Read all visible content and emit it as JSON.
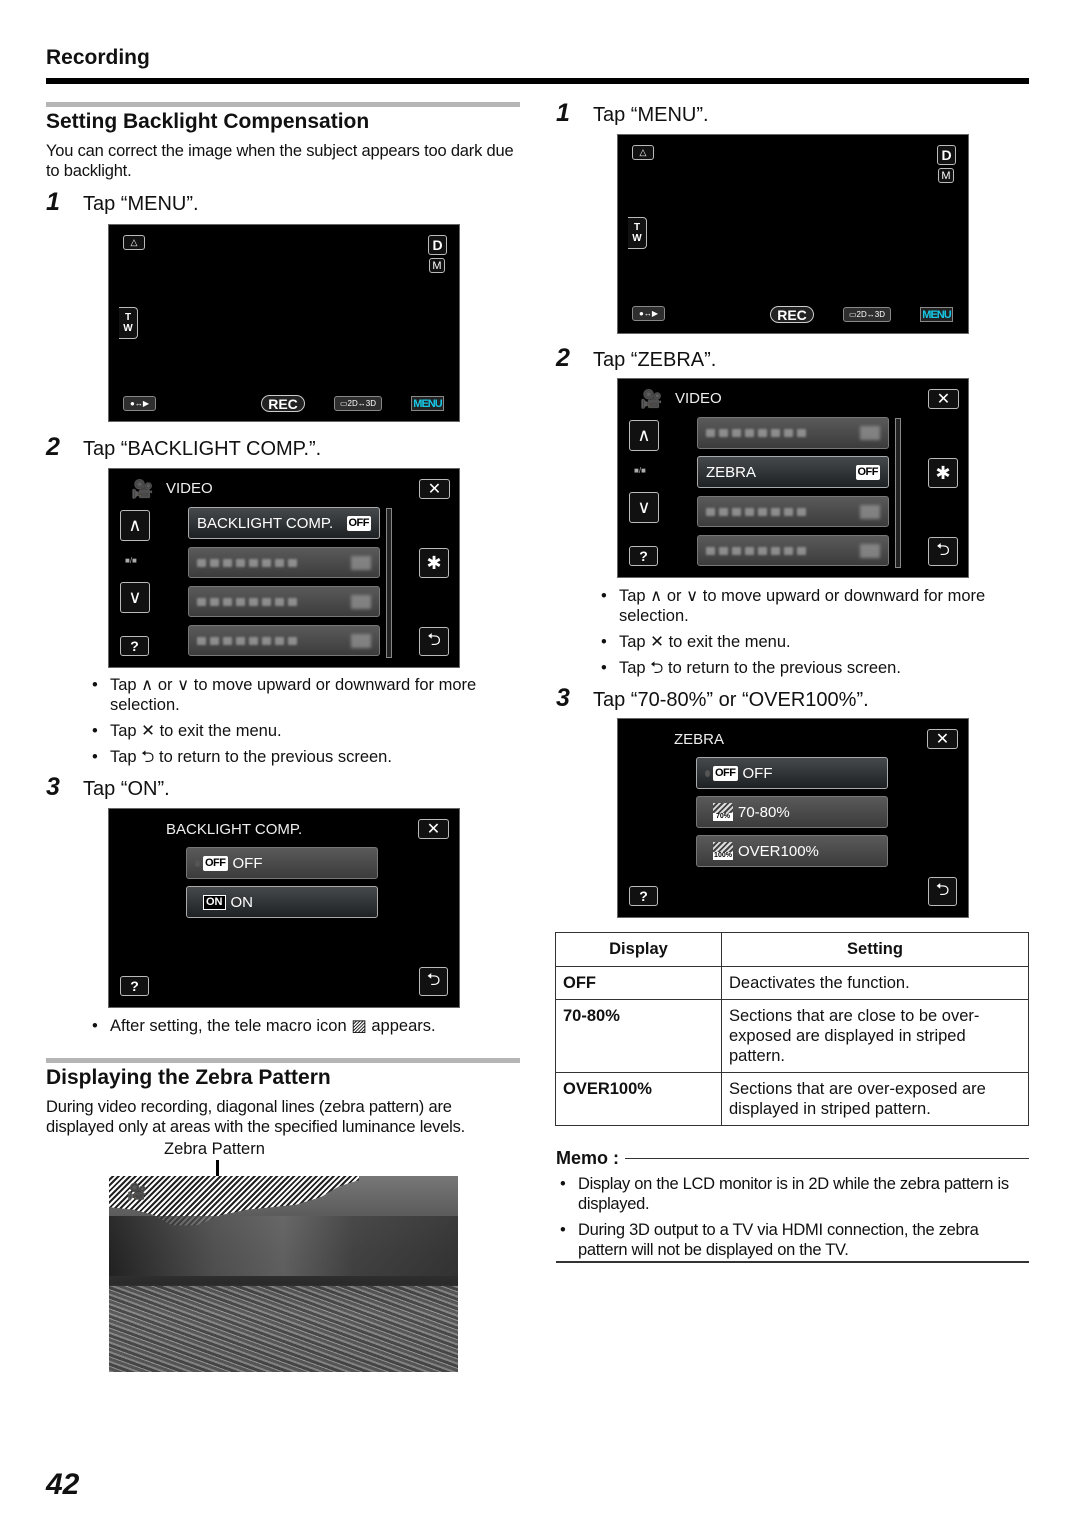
{
  "header": {
    "title": "Recording"
  },
  "left": {
    "section1": {
      "title": "Setting Backlight Compensation",
      "intro": "You can correct the image when the subject appears too dark due to backlight.",
      "step1": {
        "num": "1",
        "text": "Tap “MENU”."
      },
      "step2": {
        "num": "2",
        "text": "Tap “BACKLIGHT COMP.”."
      },
      "step3": {
        "num": "3",
        "text": "Tap “ON”."
      },
      "bullets": [
        "Tap ∧ or ∨ to move upward or downward for more selection.",
        "Tap ✕ to exit the menu.",
        "Tap ⮌ to return to the previous screen."
      ],
      "after_note": "After setting, the tele macro icon ▨ appears."
    },
    "section2": {
      "title": "Displaying the Zebra Pattern",
      "intro": "During video recording, diagonal lines (zebra pattern) are displayed only at areas with the specified luminance levels.",
      "callout": "Zebra Pattern"
    }
  },
  "right": {
    "step1": {
      "num": "1",
      "text": "Tap “MENU”."
    },
    "step2": {
      "num": "2",
      "text": "Tap “ZEBRA”."
    },
    "step3": {
      "num": "3",
      "text": "Tap “70-80%” or “OVER100%”."
    },
    "bullets": [
      "Tap ∧ or ∨ to move upward or downward for more selection.",
      "Tap ✕ to exit the menu.",
      "Tap ⮌ to return to the previous screen."
    ],
    "table": {
      "headers": [
        "Display",
        "Setting"
      ],
      "rows": [
        [
          "OFF",
          "Deactivates the function."
        ],
        [
          "70-80%",
          "Sections that are close to be over-exposed are displayed in striped pattern."
        ],
        [
          "OVER100%",
          "Sections that are over-exposed are displayed in striped pattern."
        ]
      ]
    },
    "memo": {
      "title": "Memo :",
      "items": [
        "Display on the LCD monitor is in 2D while the zebra pattern is displayed.",
        "During 3D output to a TV via HDMI connection, the zebra pattern will not be displayed on the TV."
      ]
    }
  },
  "screens": {
    "record": {
      "t": "T",
      "w": "W",
      "d": "D",
      "m": "M",
      "rec": "REC",
      "mode_3d": "▭2D↔3D",
      "menu": "MENU",
      "playback": "●↔▶",
      "menu_color": "#16c8e6"
    },
    "video_menu": {
      "title": "VIDEO",
      "page_indicator": "■/■",
      "help": "?",
      "backlight_item": "BACKLIGHT COMP.",
      "zebra_item": "ZEBRA",
      "off_badge": "OFF"
    },
    "backlight_options": {
      "title": "BACKLIGHT COMP.",
      "options": [
        {
          "badge": "OFF",
          "label": "OFF",
          "selected": true
        },
        {
          "badge": "ON",
          "label": "ON",
          "selected": false
        }
      ],
      "help": "?"
    },
    "zebra_options": {
      "title": "ZEBRA",
      "options": [
        {
          "badge": "OFF",
          "label": "OFF",
          "selected": true
        },
        {
          "badge": "70%",
          "label": "70-80%",
          "selected": false
        },
        {
          "badge": "100%",
          "label": "OVER100%",
          "selected": false
        }
      ],
      "help": "?"
    }
  },
  "page_number": "42"
}
